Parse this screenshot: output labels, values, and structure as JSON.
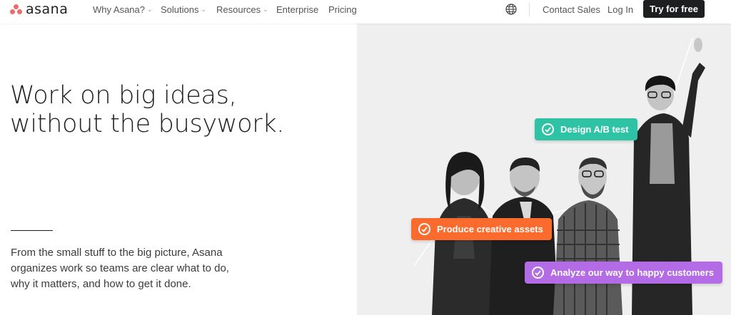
{
  "brand": {
    "name": "asana",
    "color": "#f06a6a"
  },
  "nav": {
    "links": [
      {
        "label": "Why Asana?",
        "dropdown": true
      },
      {
        "label": "Solutions",
        "dropdown": true
      },
      {
        "label": "Resources",
        "dropdown": true
      },
      {
        "label": "Enterprise",
        "dropdown": false
      },
      {
        "label": "Pricing",
        "dropdown": false
      }
    ],
    "globe_icon": "globe-icon",
    "contact_sales": "Contact Sales",
    "login": "Log In",
    "cta": "Try for free"
  },
  "hero": {
    "headline_line1": "Work on big ideas,",
    "headline_line2": "without the busywork.",
    "subtext": "From the small stuff to the big picture, Asana organizes work so teams are clear what to do, why it matters, and how to get it done."
  },
  "tasks": [
    {
      "label": "Design A/B test",
      "color": "#2fc3a6",
      "icon": "check-circle-icon"
    },
    {
      "label": "Produce creative assets",
      "color": "#fa6b2d",
      "icon": "check-circle-icon"
    },
    {
      "label": "Analyze our way to happy customers",
      "color": "#b36be6",
      "icon": "check-circle-icon"
    }
  ]
}
